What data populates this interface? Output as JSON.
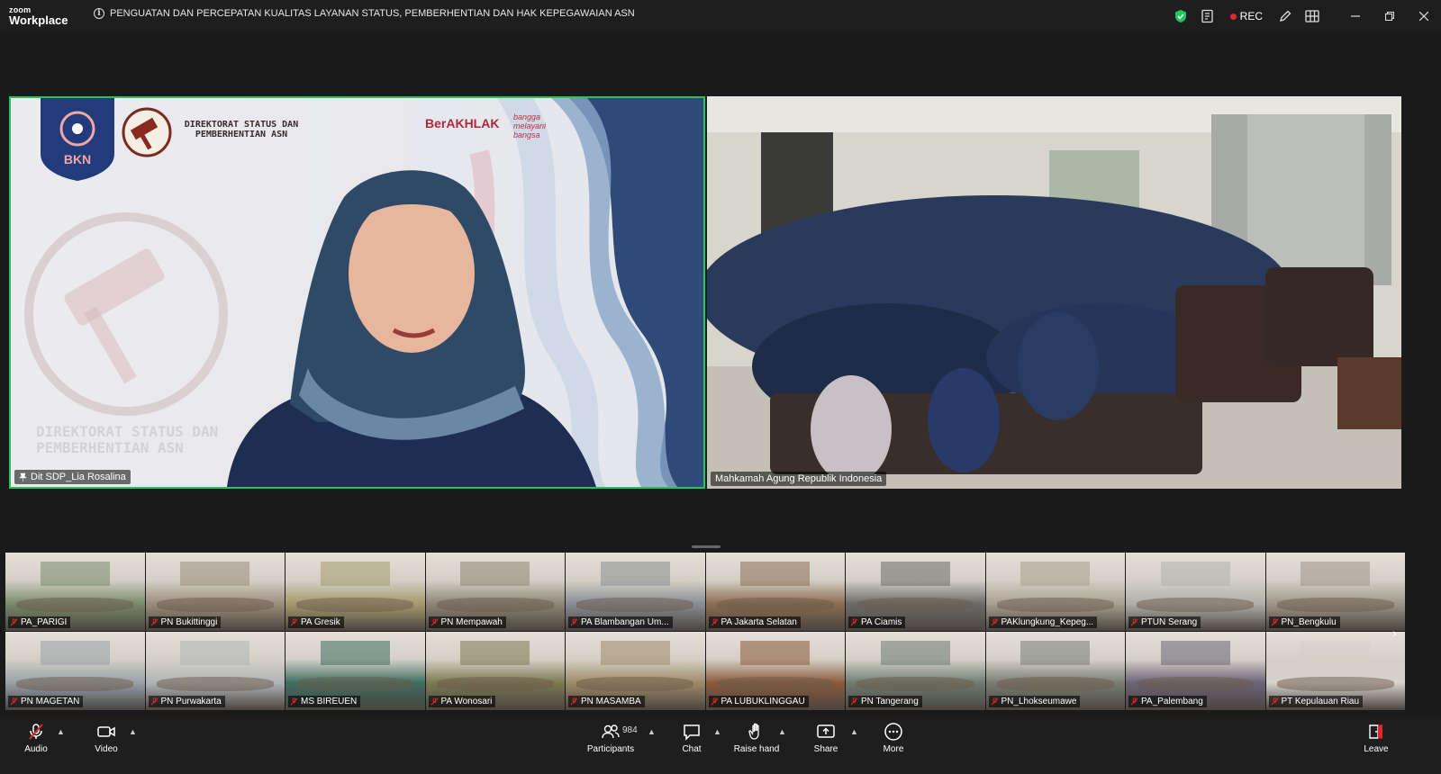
{
  "app": {
    "logo_top": "zoom",
    "logo_bottom": "Workplace"
  },
  "meeting": {
    "title": "PENGUATAN DAN PERCEPATAN KUALITAS LAYANAN STATUS, PEMBERHENTIAN DAN HAK KEPEGAWAIAN ASN"
  },
  "titlebar": {
    "rec_label": "REC"
  },
  "main_videos": [
    {
      "name": "Dit SDP_Lia Rosalina",
      "active_speaker": true
    },
    {
      "name": "Mahkamah Agung Republik Indonesia",
      "active_speaker": false
    }
  ],
  "slide": {
    "org_name": "DIREKTORAT STATUS DAN PEMBERHENTIAN ASN",
    "logo_text": "BKN",
    "brand": "BerAKHLAK",
    "tagline": "bangga melayani bangsa",
    "watermark": "DIREKTORAT STATUS DAN PEMBERHENTIAN ASN"
  },
  "gallery": [
    {
      "name": "PA_PARIGI",
      "color": "#7a8a6c"
    },
    {
      "name": "PN Bukittinggi",
      "color": "#9c8e7c"
    },
    {
      "name": "PA Gresik",
      "color": "#a69a6e"
    },
    {
      "name": "PN Mempawah",
      "color": "#8e8676"
    },
    {
      "name": "PA Blambangan Um...",
      "color": "#8a8e94"
    },
    {
      "name": "PA Jakarta Selatan",
      "color": "#8c6e52"
    },
    {
      "name": "PA Ciamis",
      "color": "#6e6c6a"
    },
    {
      "name": "PAKlungkung_Kepeg...",
      "color": "#a8a090"
    },
    {
      "name": "PTUN Serang",
      "color": "#b2b0aa"
    },
    {
      "name": "PN_Bengkulu",
      "color": "#a0968a"
    },
    {
      "name": "PN MAGETAN",
      "color": "#98a0a8"
    },
    {
      "name": "PN Purwakarta",
      "color": "#b0b4b6"
    },
    {
      "name": "MS BIREUEN",
      "color": "#3e6e62"
    },
    {
      "name": "PA Wonosari",
      "color": "#7a7a52"
    },
    {
      "name": "PN MASAMBA",
      "color": "#9e8a68"
    },
    {
      "name": "PA LUBUKLINGGAU",
      "color": "#8a5a3c"
    },
    {
      "name": "PN Tangerang",
      "color": "#6e7c72"
    },
    {
      "name": "PN_Lhokseumawe",
      "color": "#7a7e72"
    },
    {
      "name": "PA_Palembang",
      "color": "#6c6478"
    },
    {
      "name": "PT Kepulauan Riau",
      "color": "#d6d2cc"
    }
  ],
  "toolbar": {
    "audio": "Audio",
    "video": "Video",
    "participants": "Participants",
    "participants_count": "984",
    "chat": "Chat",
    "raise_hand": "Raise hand",
    "share": "Share",
    "more": "More",
    "leave": "Leave"
  },
  "colors": {
    "active_speaker": "#22c55e",
    "rec": "#e02828",
    "share": "#22c55e"
  }
}
